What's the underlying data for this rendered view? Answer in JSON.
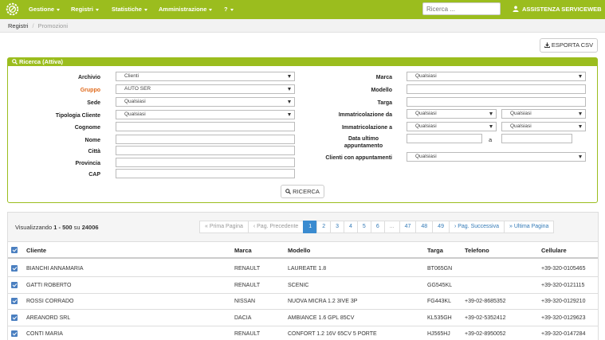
{
  "nav": {
    "items": [
      {
        "label": "Gestione"
      },
      {
        "label": "Registri"
      },
      {
        "label": "Statistiche"
      },
      {
        "label": "Amministrazione"
      },
      {
        "label": "?"
      }
    ],
    "search_placeholder": "Ricerca ...",
    "user": "ASSISTENZA SERVICEWEB",
    "logo_icon": "gear-wrench-icon",
    "user_icon": "user-icon",
    "brand_color": "#9bbd1e"
  },
  "breadcrumb": {
    "items": [
      "Registri",
      "Promozioni"
    ],
    "separator": "/"
  },
  "export_button": {
    "label": "ESPORTA CSV",
    "icon": "download-icon"
  },
  "search_panel": {
    "title": "Ricerca (Attiva)",
    "icon": "search-icon",
    "left": {
      "archivio": {
        "label": "Archivio",
        "value": "Clienti"
      },
      "gruppo": {
        "label": "Gruppo",
        "value": "AUTO SER"
      },
      "sede": {
        "label": "Sede",
        "value": "Qualsiasi"
      },
      "tipologia": {
        "label": "Tipologia Cliente",
        "value": "Qualsiasi"
      },
      "cognome": {
        "label": "Cognome",
        "value": ""
      },
      "nome": {
        "label": "Nome",
        "value": ""
      },
      "citta": {
        "label": "Città",
        "value": ""
      },
      "provincia": {
        "label": "Provincia",
        "value": ""
      },
      "cap": {
        "label": "CAP",
        "value": ""
      }
    },
    "right": {
      "marca": {
        "label": "Marca",
        "value": "Qualsiasi"
      },
      "modello": {
        "label": "Modello",
        "value": ""
      },
      "targa": {
        "label": "Targa",
        "value": ""
      },
      "immatricolazione_da": {
        "label": "Immatricolazione da",
        "value1": "Qualsiasi",
        "value2": "Qualsiasi"
      },
      "immatricolazione_a": {
        "label": "Immatricolazione a",
        "value1": "Qualsiasi",
        "value2": "Qualsiasi"
      },
      "data_ultimo": {
        "label1": "Data ultimo",
        "label2": "appuntamento",
        "value_from": "",
        "between": "a",
        "value_to": ""
      },
      "clienti_appuntamenti": {
        "label": "Clienti con appuntamenti",
        "value": "Qualsiasi"
      }
    },
    "search_button": {
      "label": "RICERCA",
      "icon": "search-icon"
    }
  },
  "results": {
    "summary_prefix": "Visualizzando ",
    "range": "1 - 500",
    "summary_mid": " su ",
    "total": "24006",
    "pagination": [
      {
        "label": "« Prima Pagina",
        "state": "disabled"
      },
      {
        "label": "‹ Pag. Precedente",
        "state": "disabled"
      },
      {
        "label": "1",
        "state": "active"
      },
      {
        "label": "2",
        "state": ""
      },
      {
        "label": "3",
        "state": ""
      },
      {
        "label": "4",
        "state": ""
      },
      {
        "label": "5",
        "state": ""
      },
      {
        "label": "6",
        "state": ""
      },
      {
        "label": "...",
        "state": "disabled"
      },
      {
        "label": "47",
        "state": ""
      },
      {
        "label": "48",
        "state": ""
      },
      {
        "label": "49",
        "state": ""
      },
      {
        "label": "› Pag. Successiva",
        "state": ""
      },
      {
        "label": "» Ultima Pagina",
        "state": ""
      }
    ],
    "columns": [
      "Cliente",
      "Marca",
      "Modello",
      "Targa",
      "Telefono",
      "Cellulare"
    ],
    "rows": [
      {
        "cliente": "BIANCHI ANNAMARIA",
        "marca": "RENAULT",
        "modello": "LAUREATE 1.8",
        "targa": "BT065GN",
        "telefono": "",
        "cellulare": "+39-320-0105465"
      },
      {
        "cliente": "GATTI ROBERTO",
        "marca": "RENAULT",
        "modello": "SCENIC",
        "targa": "GG545KL",
        "telefono": "",
        "cellulare": "+39-320-0121115"
      },
      {
        "cliente": "ROSSI CORRADO",
        "marca": "NISSAN",
        "modello": "NUOVA MICRA 1.2 3IVE 3P",
        "targa": "FG443KL",
        "telefono": "+39-02-8685352",
        "cellulare": "+39-320-0129210"
      },
      {
        "cliente": "AREANORD SRL",
        "marca": "DACIA",
        "modello": "AMBIANCE 1.6 GPL 85CV",
        "targa": "KL535GH",
        "telefono": "+39-02-5352412",
        "cellulare": "+39-320-0129623"
      },
      {
        "cliente": "CONTI MARIA",
        "marca": "RENAULT",
        "modello": "CONFORT 1.2 16V 65CV 5 PORTE",
        "targa": "HJ565HJ",
        "telefono": "+39-02-8950052",
        "cellulare": "+39-320-0147284"
      }
    ]
  }
}
